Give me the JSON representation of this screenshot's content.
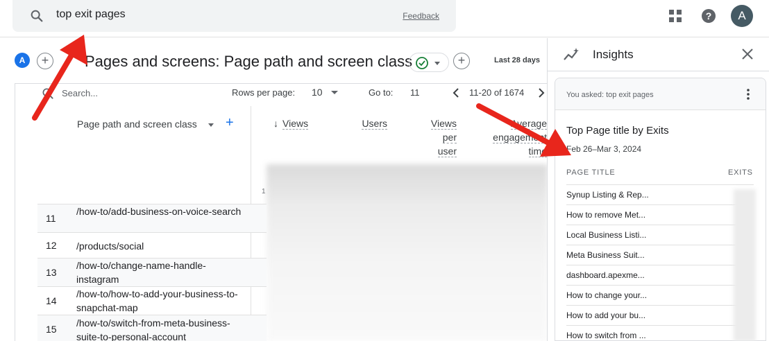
{
  "search": {
    "query": "top exit pages",
    "feedback_label": "Feedback",
    "icon": "search-icon"
  },
  "topbar": {
    "apps_icon": "apps-grid-icon",
    "help_icon": "help-icon",
    "avatar_letter": "A"
  },
  "report": {
    "segment_letter": "A",
    "title": "Pages and screens: Page path and screen class",
    "date_range": "Last 28 days"
  },
  "table": {
    "search_placeholder": "Search...",
    "rows_per_page_label": "Rows per page:",
    "rows_per_page_value": "10",
    "goto_label": "Go to:",
    "goto_value": "11",
    "range_label": "11-20 of 1674",
    "dimension_header": "Page path and screen class",
    "metric_headers": {
      "views": "Views",
      "users": "Users",
      "views_per_user": [
        "Views",
        "per",
        "user"
      ],
      "average": [
        "Average",
        "engagement",
        "time"
      ]
    },
    "first_row_num_fragment": "1",
    "rows": [
      {
        "num": "11",
        "path": "/how-to/add-business-on-voice-search"
      },
      {
        "num": "12",
        "path": "/products/social"
      },
      {
        "num": "13",
        "path": "/how-to/change-name-handle-instagram"
      },
      {
        "num": "14",
        "path": "/how-to/how-to-add-your-business-to-snapchat-map"
      },
      {
        "num": "15",
        "path": "/how-to/switch-from-meta-business-suite-to-personal-account"
      }
    ]
  },
  "insights": {
    "title": "Insights",
    "asked": "You asked: top exit pages",
    "card_title": "Top Page title by Exits",
    "card_date": "Feb 26–Mar 3, 2024",
    "col_page_title": "PAGE TITLE",
    "col_exits": "EXITS",
    "rows": [
      "Synup Listing & Rep...",
      "How to remove Met...",
      "Local Business Listi...",
      "Meta Business Suit...",
      "dashboard.apexme...",
      "How to change your...",
      "How to add your bu...",
      "How to switch from ..."
    ]
  },
  "colors": {
    "accent": "#1a73e8",
    "annotation": "#e8261c",
    "avatar_bg": "#455a64",
    "check_green": "#188038"
  }
}
